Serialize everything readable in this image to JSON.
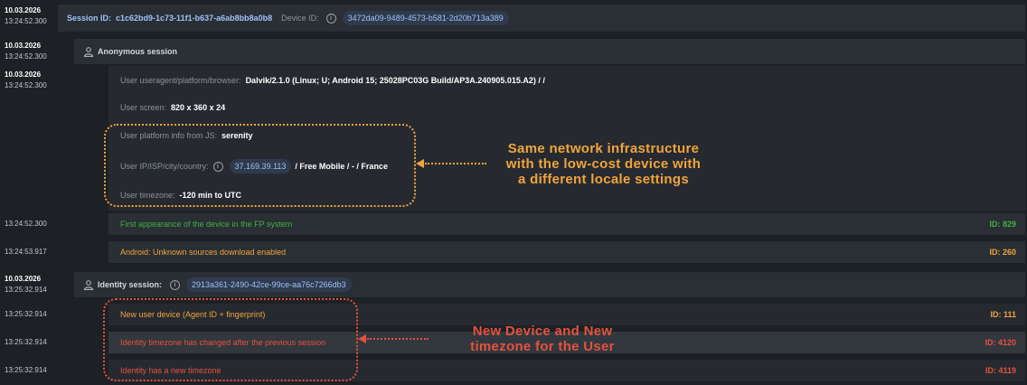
{
  "session_header": {
    "date": "10.03.2026",
    "time": "13:24:52.300",
    "session_id_label": "Session ID:",
    "session_id": "c1c62bd9-1c73-11f1-b637-a6ab8bb8a0b8",
    "device_id_label": "Device ID:",
    "device_id": "3472da09-9489-4573-b581-2d20b713a389"
  },
  "anonymous": {
    "date": "10.03.2026",
    "time": "13:24:52.300",
    "title": "Anonymous session"
  },
  "details": {
    "date": "10.03.2026",
    "time": "13:24:52.300",
    "useragent_label": "User useragent/platform/browser:",
    "useragent_value": "Dalvik/2.1.0 (Linux; U; Android 15; 25028PC03G Build/AP3A.240905.015.A2) / /",
    "screen_label": "User screen:",
    "screen_value": "820 x 360 x 24",
    "platform_label": "User platform info from JS:",
    "platform_value": "serenity",
    "ip_label": "User IP/ISP/city/country:",
    "ip_value": "37.169.39.113",
    "isp_value": "/ Free Mobile / - / France",
    "tz_label": "User timezone:",
    "tz_value": "-120 min to UTC"
  },
  "events_anon": [
    {
      "time": "13:24:52.300",
      "text": "First appearance of the device in the FP system",
      "id": "ID: 829",
      "color": "#3fb344"
    },
    {
      "time": "13:24:53.917",
      "text": "Android: Unknown sources download enabled",
      "id": "ID: 260",
      "color": "#f0a43c"
    }
  ],
  "identity": {
    "date": "10.03.2026",
    "time": "13:25:32.914",
    "label": "Identity session:",
    "id": "2913a361-2490-42ce-99ce-aa76c7266db3"
  },
  "events_identity": [
    {
      "time": "13:25:32.914",
      "text": "New user device (Agent ID + fingerprint)",
      "id": "ID: 111",
      "color": "#f0a43c"
    },
    {
      "time": "13:25:32.914",
      "text": "Identity timezone has changed after the previous session",
      "id": "ID: 4120",
      "color": "#e5523f"
    },
    {
      "time": "13:25:32.914",
      "text": "Identity has a new timezone",
      "id": "ID: 4119",
      "color": "#e5523f"
    }
  ],
  "annotations": {
    "network_line1": "Same network infrastructure",
    "network_line2": "with the low-cost device with",
    "network_line3": "a different locale settings",
    "network_color": "#f0a43c",
    "device_line1": "New Device and New",
    "device_line2": "timezone for the User",
    "device_color": "#e5523f"
  },
  "icons": {
    "info": "info-icon",
    "person": "person-icon"
  }
}
